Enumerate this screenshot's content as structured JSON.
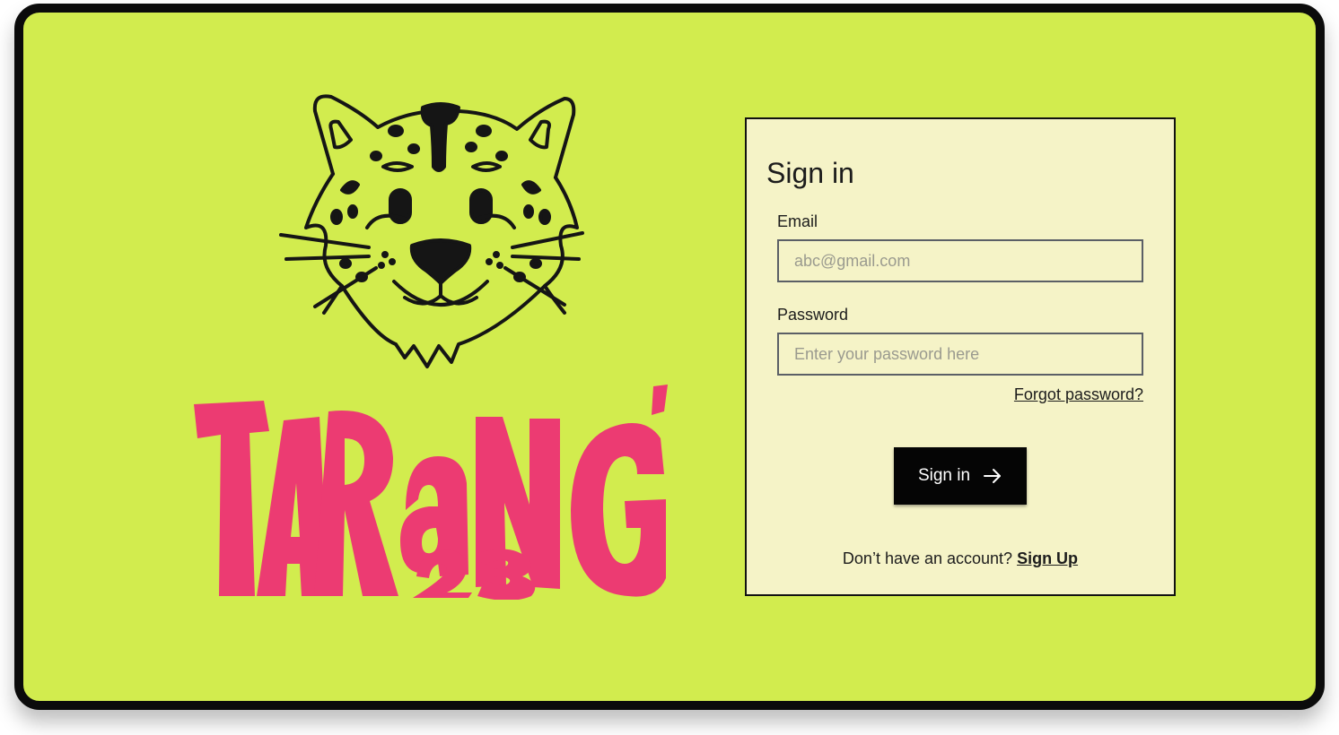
{
  "brand": {
    "mascot_icon": "leopard-head-icon",
    "logo_text": "TaRaNG'",
    "logo_year": "23",
    "logo_color": "#ec3b72",
    "background_color": "#d2ec4e"
  },
  "signin": {
    "title": "Sign in",
    "email_label": "Email",
    "email_placeholder": "abc@gmail.com",
    "password_label": "Password",
    "password_placeholder": "Enter your password here",
    "forgot_label": "Forgot password?",
    "submit_label": "Sign in",
    "submit_icon": "arrow-right-icon",
    "no_account_text": "Don’t have an account?",
    "signup_label": "Sign Up",
    "card_color": "#f5f3c7"
  }
}
